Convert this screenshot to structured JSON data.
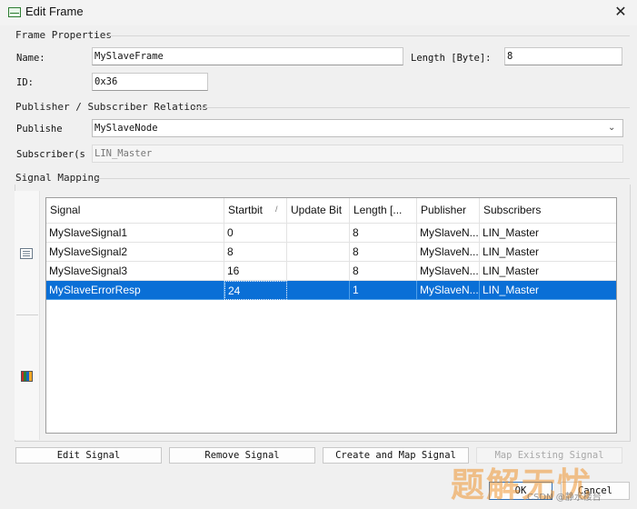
{
  "window": {
    "title": "Edit Frame",
    "close_glyph": "✕"
  },
  "frame_properties": {
    "title": "Frame Properties",
    "name_label": "Name:",
    "name_value": "MySlaveFrame",
    "length_label": "Length [Byte]:",
    "length_value": "8",
    "id_label": "ID:",
    "id_value": "0x36"
  },
  "relations": {
    "title": "Publisher / Subscriber Relations",
    "publisher_label": "Publishe",
    "publisher_value": "MySlaveNode",
    "subscriber_label": "Subscriber(s",
    "subscriber_value": "LIN_Master"
  },
  "signal_mapping": {
    "title": "Signal Mapping",
    "sort_indicator": "/",
    "columns": [
      "Signal",
      "Startbit",
      "Update Bit",
      "Length [...",
      "Publisher",
      "Subscribers"
    ],
    "rows": [
      [
        "MySlaveSignal1",
        "0",
        "",
        "8",
        "MySlaveN...",
        "LIN_Master"
      ],
      [
        "MySlaveSignal2",
        "8",
        "",
        "8",
        "MySlaveN...",
        "LIN_Master"
      ],
      [
        "MySlaveSignal3",
        "16",
        "",
        "8",
        "MySlaveN...",
        "LIN_Master"
      ],
      [
        "MySlaveErrorResp",
        "24",
        "",
        "1",
        "MySlaveN...",
        "LIN_Master"
      ]
    ],
    "selected_row": 3
  },
  "buttons": {
    "edit_signal": "Edit Signal",
    "remove_signal": "Remove Signal",
    "create_map_signal": "Create and Map Signal",
    "map_existing_signal": "Map Existing Signal",
    "ok": "OK",
    "cancel": "Cancel"
  },
  "overlay": {
    "watermark": "题解无忧",
    "csdn": "CSDN @静水楼台"
  },
  "icons": {
    "app": "frame-window-icon",
    "properties": "properties-icon",
    "palette": "color-palette-icon",
    "dropdown": "chevron-down-icon"
  }
}
